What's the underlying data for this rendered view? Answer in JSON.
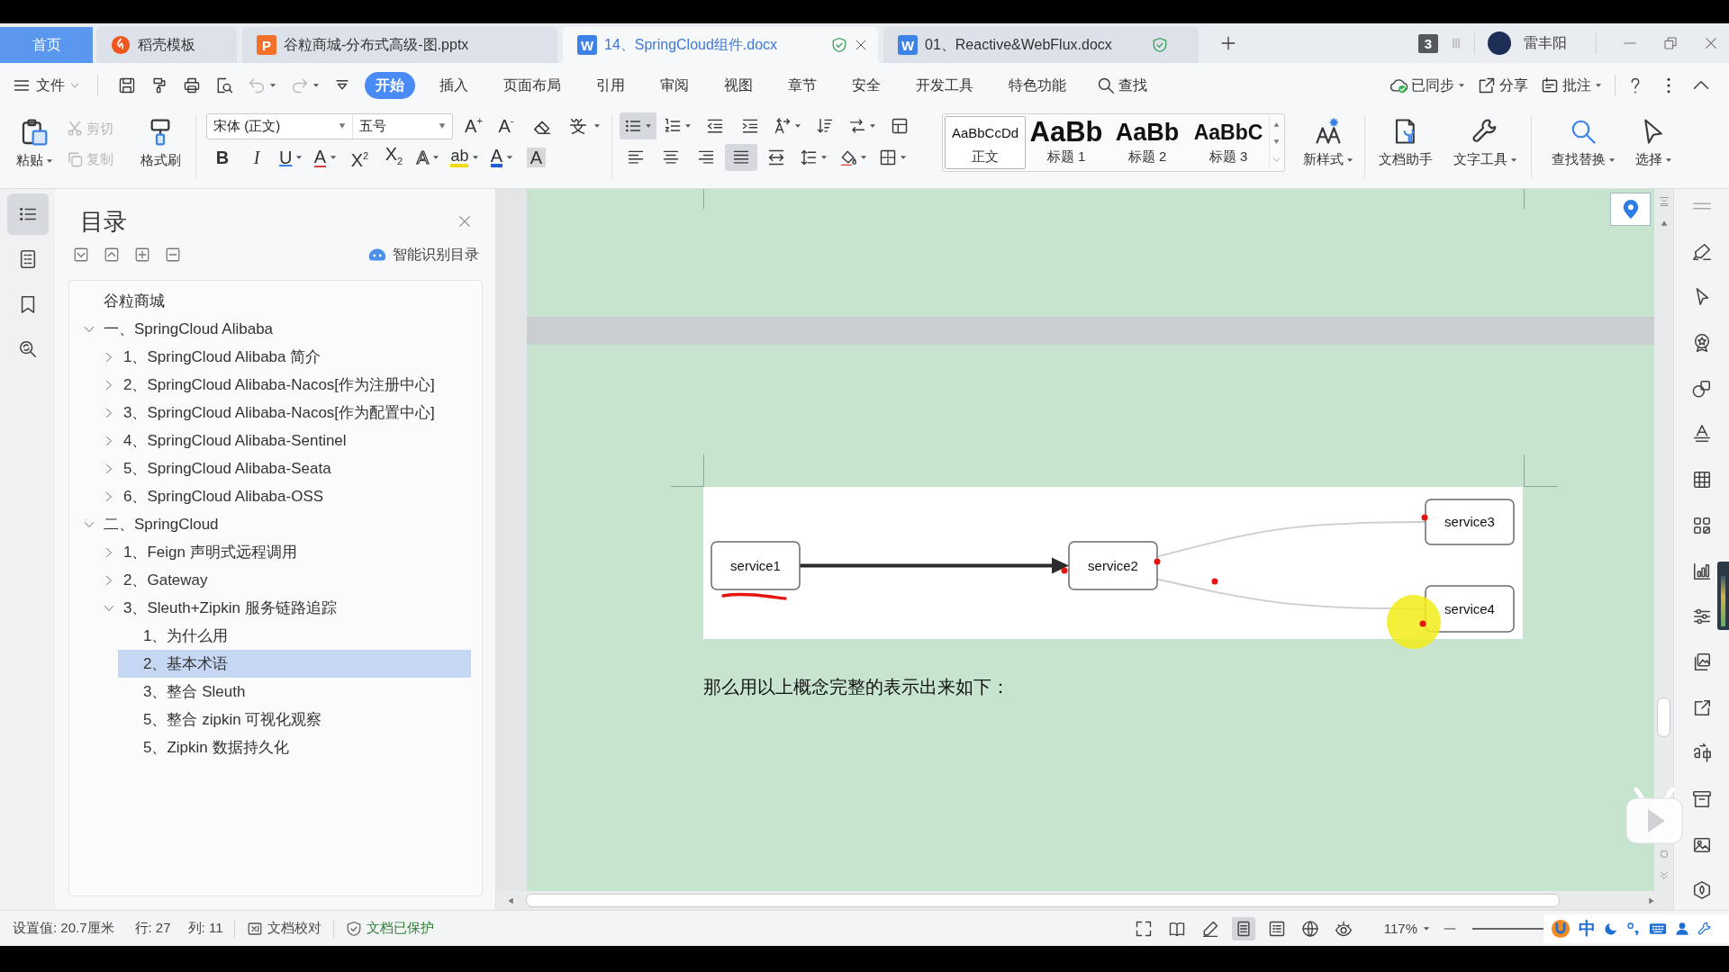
{
  "tabs": [
    {
      "label": "首页",
      "kind": "home",
      "selected": false,
      "protected": false
    },
    {
      "label": "稻壳模板",
      "kind": "docer",
      "selected": false,
      "protected": false
    },
    {
      "label": "谷粒商城-分布式高级-图.pptx",
      "kind": "ppt",
      "badge": "P",
      "selected": false,
      "protected": false
    },
    {
      "label": "14、SpringCloud组件.docx",
      "kind": "doc",
      "badge": "W",
      "selected": true,
      "protected": true
    },
    {
      "label": "01、Reactive&WebFlux.docx",
      "kind": "doc",
      "badge": "W",
      "selected": false,
      "protected": true
    }
  ],
  "window": {
    "tab_count": "3",
    "user": "雷丰阳"
  },
  "menu": {
    "file": "文件",
    "items": [
      {
        "label": "开始",
        "selected": true
      },
      {
        "label": "插入",
        "selected": false
      },
      {
        "label": "页面布局",
        "selected": false
      },
      {
        "label": "引用",
        "selected": false
      },
      {
        "label": "审阅",
        "selected": false
      },
      {
        "label": "视图",
        "selected": false
      },
      {
        "label": "章节",
        "selected": false
      },
      {
        "label": "安全",
        "selected": false
      },
      {
        "label": "开发工具",
        "selected": false
      },
      {
        "label": "特色功能",
        "selected": false
      }
    ],
    "search": "查找",
    "actions": [
      {
        "label": "已同步",
        "kind": "sync",
        "dropdown": true
      },
      {
        "label": "分享",
        "kind": "share",
        "dropdown": false
      },
      {
        "label": "批注",
        "kind": "comment",
        "dropdown": true
      }
    ]
  },
  "ribbon": {
    "paste": {
      "label": "粘贴",
      "disabled": false
    },
    "cut": {
      "label": "剪切",
      "disabled": true
    },
    "copy": {
      "label": "复制",
      "disabled": true
    },
    "format_painter": {
      "label": "格式刷",
      "disabled": false
    },
    "font": {
      "name": "宋体 (正文)",
      "size": "五号",
      "size_buttons": [
        "A$^{+}$",
        "A$^{-}$"
      ],
      "format_buttons": [
        {
          "label": "B",
          "kind": "bold",
          "dropdown": false
        },
        {
          "label": "I",
          "kind": "italic",
          "dropdown": false
        },
        {
          "label": "U",
          "kind": "underline",
          "dropdown": true
        },
        {
          "label": "A",
          "kind": "strike",
          "dropdown": true
        },
        {
          "label": "X$^{2}$",
          "kind": "superscript",
          "dropdown": false
        },
        {
          "label": "X$_{2}$",
          "kind": "subscript",
          "dropdown": false
        },
        {
          "label": "A",
          "kind": "outline",
          "dropdown": true
        },
        {
          "label": "ab",
          "kind": "highlight",
          "dropdown": true
        },
        {
          "label": "A",
          "kind": "color",
          "dropdown": true
        },
        {
          "label": "A",
          "kind": "shade",
          "dropdown": false
        }
      ]
    },
    "paragraph": [
      [
        {
          "kind": "bullets",
          "selected": true,
          "dropdown": true
        },
        {
          "kind": "numbering",
          "selected": false,
          "dropdown": true
        },
        {
          "kind": "outdent",
          "selected": false,
          "dropdown": false
        },
        {
          "kind": "indent",
          "selected": false,
          "dropdown": false
        },
        {
          "kind": "text_direction",
          "selected": false,
          "dropdown": true
        },
        {
          "kind": "sort",
          "selected": false,
          "dropdown": false
        },
        {
          "kind": "spacing",
          "selected": false,
          "dropdown": true
        },
        {
          "kind": "table",
          "selected": false,
          "dropdown": false
        }
      ],
      [
        {
          "kind": "align_left",
          "selected": false,
          "dropdown": false
        },
        {
          "kind": "align_center",
          "selected": false,
          "dropdown": false
        },
        {
          "kind": "align_right",
          "selected": false,
          "dropdown": false
        },
        {
          "kind": "justify",
          "selected": true,
          "dropdown": false
        },
        {
          "kind": "distribute",
          "selected": false,
          "dropdown": false
        },
        {
          "kind": "line_spacing",
          "selected": false,
          "dropdown": true
        },
        {
          "kind": "shading",
          "selected": false,
          "dropdown": true
        },
        {
          "kind": "borders",
          "selected": false,
          "dropdown": true
        }
      ]
    ],
    "styles": [
      {
        "preview": "AaBbCcDd",
        "label": "正文",
        "kind": "body",
        "selected": true
      },
      {
        "preview": "AaBb",
        "label": "标题 1",
        "kind": "h1",
        "selected": false
      },
      {
        "preview": "AaBb",
        "label": "标题 2",
        "kind": "h2",
        "selected": false
      },
      {
        "preview": "AaBbC",
        "label": "标题 3",
        "kind": "h3",
        "selected": false
      }
    ],
    "tools": [
      {
        "label": "新样式",
        "kind": "new_style",
        "dropdown": true
      },
      {
        "label": "文档助手",
        "kind": "assistant",
        "dropdown": false
      },
      {
        "label": "文字工具",
        "kind": "text_tools",
        "dropdown": true
      },
      {
        "label": "查找替换",
        "kind": "find_replace",
        "dropdown": true
      },
      {
        "label": "选择",
        "kind": "select",
        "dropdown": true
      }
    ]
  },
  "sidebar_tabs": [
    {
      "kind": "toc",
      "selected": true
    },
    {
      "kind": "pages",
      "selected": false
    },
    {
      "kind": "bookmarks",
      "selected": false
    },
    {
      "kind": "find",
      "selected": false
    }
  ],
  "nav": {
    "title": "目录",
    "smart_toc": "智能识别目录",
    "tree": [
      {
        "label": "谷粒商城",
        "selected": false
      },
      {
        "label": "一、SpringCloud Alibaba",
        "expanded": true,
        "selected": false,
        "children": [
          {
            "label": "1、SpringCloud Alibaba 简介",
            "expanded": false,
            "selected": false
          },
          {
            "label": "2、SpringCloud Alibaba-Nacos[作为注册中心]",
            "expanded": false,
            "selected": false
          },
          {
            "label": "3、SpringCloud Alibaba-Nacos[作为配置中心]",
            "expanded": false,
            "selected": false
          },
          {
            "label": "4、SpringCloud Alibaba-Sentinel",
            "expanded": false,
            "selected": false
          },
          {
            "label": "5、SpringCloud Alibaba-Seata",
            "expanded": false,
            "selected": false
          },
          {
            "label": "6、SpringCloud Alibaba-OSS",
            "expanded": false,
            "selected": false
          }
        ]
      },
      {
        "label": "二、SpringCloud",
        "expanded": true,
        "selected": false,
        "children": [
          {
            "label": "1、Feign 声明式远程调用",
            "expanded": false,
            "selected": false
          },
          {
            "label": "2、Gateway",
            "expanded": false,
            "selected": false
          },
          {
            "label": "3、Sleuth+Zipkin 服务链路追踪",
            "expanded": true,
            "selected": false,
            "children": [
              {
                "label": "1、为什么用",
                "selected": false
              },
              {
                "label": "2、基本术语",
                "selected": true
              },
              {
                "label": "3、整合 Sleuth",
                "selected": false
              },
              {
                "label": "5、整合 zipkin 可视化观察",
                "selected": false
              },
              {
                "label": "5、Zipkin 数据持久化",
                "selected": false
              }
            ]
          }
        ]
      }
    ]
  },
  "document": {
    "diagram": {
      "nodes": [
        {
          "label": "service1"
        },
        {
          "label": "service2"
        },
        {
          "label": "service3"
        },
        {
          "label": "service4"
        }
      ]
    },
    "paragraph": "那么用以上概念完整的表示出来如下："
  },
  "status_bar": {
    "position": "设置值: 20.7厘米",
    "row": "行: 27",
    "column": "列: 11",
    "proofread": "文档校对",
    "protection": "文档已保护",
    "view_modes": [
      {
        "kind": "fullscreen",
        "selected": false
      },
      {
        "kind": "reading",
        "selected": false
      },
      {
        "kind": "edit",
        "selected": false
      },
      {
        "kind": "page",
        "selected": true
      },
      {
        "kind": "outline",
        "selected": false
      },
      {
        "kind": "web",
        "selected": false
      },
      {
        "kind": "eye_care",
        "selected": false
      }
    ],
    "zoom": "117%"
  },
  "ime": {
    "mode": "中"
  }
}
